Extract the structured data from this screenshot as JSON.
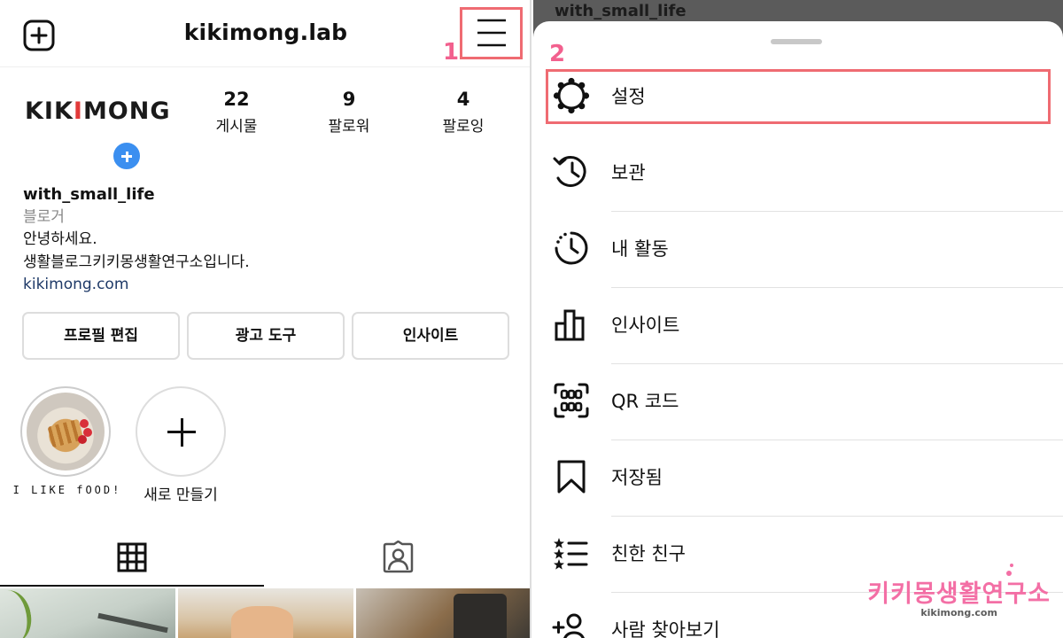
{
  "profile": {
    "header": {
      "username": "kikimong.lab"
    },
    "annotations": {
      "step_1": "1",
      "step_2": "2"
    },
    "logo_text": {
      "part1": "KIK",
      "part2": "I",
      "part3": "MONG"
    },
    "stats": [
      {
        "value": "22",
        "label": "게시물"
      },
      {
        "value": "9",
        "label": "팔로워"
      },
      {
        "value": "4",
        "label": "팔로잉"
      }
    ],
    "bio": {
      "name": "with_small_life",
      "category": "블로거",
      "line1": "안녕하세요.",
      "line2": "생활블로그키키몽생활연구소입니다.",
      "link": "kikimong.com"
    },
    "buttons": {
      "edit_profile": "프로필 편집",
      "ad_tools": "광고 도구",
      "insights": "인사이트"
    },
    "highlights": [
      {
        "label": "I LIKE fOOD!"
      },
      {
        "label": "새로 만들기"
      }
    ],
    "tabs": {
      "posts_icon": "grid-icon",
      "tagged_icon": "person-tag-icon"
    }
  },
  "sheet": {
    "behind_text": "with_small_life",
    "items": [
      {
        "label": "설정",
        "icon": "settings-gear-icon"
      },
      {
        "label": "보관",
        "icon": "archive-history-icon"
      },
      {
        "label": "내 활동",
        "icon": "activity-clock-icon"
      },
      {
        "label": "인사이트",
        "icon": "insights-bar-chart-icon"
      },
      {
        "label": "QR 코드",
        "icon": "qr-code-icon"
      },
      {
        "label": "저장됨",
        "icon": "bookmark-icon"
      },
      {
        "label": "친한 친구",
        "icon": "close-friends-list-icon"
      },
      {
        "label": "사람 찾아보기",
        "icon": "add-person-icon"
      }
    ]
  },
  "watermark": {
    "main": "키키몽생활연구소",
    "sub": "kikimong.com"
  },
  "colors": {
    "highlight_box": "#ef6b72",
    "annotation_number": "#f2608e",
    "add_story_button": "#3b8ff0",
    "watermark": "#f36fa5"
  }
}
